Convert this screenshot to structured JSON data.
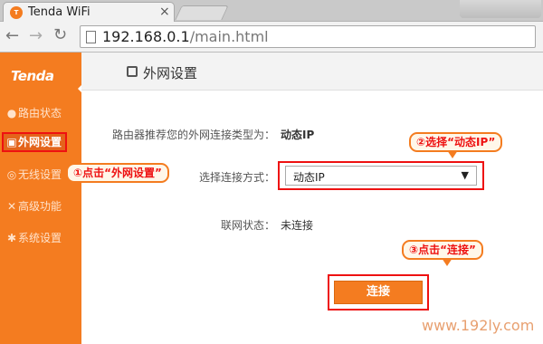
{
  "browser": {
    "tab_title": "Tenda WiFi",
    "tab_close": "×",
    "tab_icon_text": "T",
    "url_host": "192.168.0.1",
    "url_path": "/main.html"
  },
  "sidebar": {
    "logo": "Tenda",
    "items": [
      {
        "label": "路由状态",
        "icon": "●"
      },
      {
        "label": "外网设置",
        "icon": "▣"
      },
      {
        "label": "无线设置",
        "icon": "◎"
      },
      {
        "label": "高级功能",
        "icon": "✕"
      },
      {
        "label": "系统设置",
        "icon": "✱"
      }
    ]
  },
  "header": {
    "title": "外网设置"
  },
  "form": {
    "recommend_label": "路由器推荐您的外网连接类型为：",
    "recommend_value": "动态IP",
    "method_label": "选择连接方式：",
    "method_value": "动态IP",
    "status_label": "联网状态：",
    "status_value": "未连接",
    "connect_button": "连接"
  },
  "callouts": {
    "step1": "①点击“外网设置”",
    "step2": "②选择“动态IP”",
    "step3": "③点击“连接”"
  },
  "watermark": "www.192ly.com",
  "colors": {
    "accent": "#f47c20",
    "highlight": "#ee1111"
  }
}
